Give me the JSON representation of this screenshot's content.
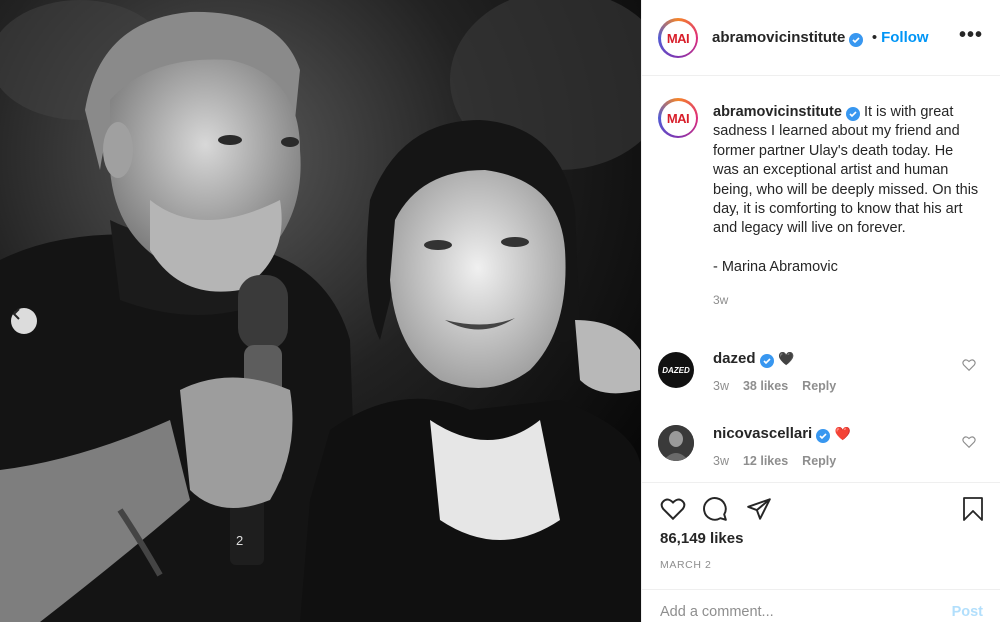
{
  "post": {
    "account": {
      "username": "abramovicinstitute",
      "avatar_text": "MAI",
      "verified": true,
      "follow_label": "Follow",
      "dot": "•",
      "more_label": "•••"
    },
    "caption": {
      "username": "abramovicinstitute",
      "text": "It is with great sadness I learned about my friend and former partner Ulay's death today. He was an exceptional artist and human being, who will be deeply missed. On this day, it is comforting to know that his art and legacy will live on forever.",
      "signature": "- Marina Abramovic",
      "time": "3w"
    },
    "comments": [
      {
        "username": "dazed",
        "avatar_text": "DAZED",
        "emoji": "🖤",
        "time": "3w",
        "likes": "38 likes",
        "reply": "Reply"
      },
      {
        "username": "nicovascellari",
        "emoji": "❤️",
        "time": "3w",
        "likes": "12 likes",
        "reply": "Reply"
      }
    ],
    "likes": "86,149 likes",
    "date": "MARCH 2",
    "add_comment": {
      "placeholder": "Add a comment...",
      "post_label": "Post"
    }
  },
  "icons": [
    "chevron-left-icon",
    "verified-badge-icon",
    "more-icon",
    "heart-icon",
    "comment-icon",
    "share-icon",
    "bookmark-icon"
  ],
  "colors": {
    "accent": "#0095f6",
    "verified": "#3897f0",
    "mai_red": "#d81e2a",
    "muted": "#8e8e8e"
  }
}
